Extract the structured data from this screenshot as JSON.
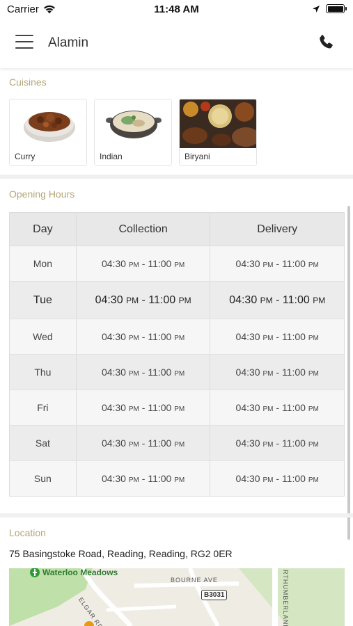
{
  "status_bar": {
    "carrier": "Carrier",
    "time": "11:48 AM"
  },
  "header": {
    "title": "Alamin"
  },
  "cuisines": {
    "label": "Cuisines",
    "items": [
      {
        "label": "Curry"
      },
      {
        "label": "Indian"
      },
      {
        "label": "Biryani"
      }
    ]
  },
  "opening_hours": {
    "label": "Opening Hours",
    "columns": [
      "Day",
      "Collection",
      "Delivery"
    ],
    "rows": [
      {
        "day": "Mon",
        "collection": {
          "open": "04:30",
          "open_ampm": "PM",
          "close": "11:00",
          "close_ampm": "PM"
        },
        "delivery": {
          "open": "04:30",
          "open_ampm": "PM",
          "close": "11:00",
          "close_ampm": "PM"
        }
      },
      {
        "day": "Tue",
        "collection": {
          "open": "04:30",
          "open_ampm": "PM",
          "close": "11:00",
          "close_ampm": "PM"
        },
        "delivery": {
          "open": "04:30",
          "open_ampm": "PM",
          "close": "11:00",
          "close_ampm": "PM"
        }
      },
      {
        "day": "Wed",
        "collection": {
          "open": "04:30",
          "open_ampm": "PM",
          "close": "11:00",
          "close_ampm": "PM"
        },
        "delivery": {
          "open": "04:30",
          "open_ampm": "PM",
          "close": "11:00",
          "close_ampm": "PM"
        }
      },
      {
        "day": "Thu",
        "collection": {
          "open": "04:30",
          "open_ampm": "PM",
          "close": "11:00",
          "close_ampm": "PM"
        },
        "delivery": {
          "open": "04:30",
          "open_ampm": "PM",
          "close": "11:00",
          "close_ampm": "PM"
        }
      },
      {
        "day": "Fri",
        "collection": {
          "open": "04:30",
          "open_ampm": "PM",
          "close": "11:00",
          "close_ampm": "PM"
        },
        "delivery": {
          "open": "04:30",
          "open_ampm": "PM",
          "close": "11:00",
          "close_ampm": "PM"
        }
      },
      {
        "day": "Sat",
        "collection": {
          "open": "04:30",
          "open_ampm": "PM",
          "close": "11:00",
          "close_ampm": "PM"
        },
        "delivery": {
          "open": "04:30",
          "open_ampm": "PM",
          "close": "11:00",
          "close_ampm": "PM"
        }
      },
      {
        "day": "Sun",
        "collection": {
          "open": "04:30",
          "open_ampm": "PM",
          "close": "11:00",
          "close_ampm": "PM"
        },
        "delivery": {
          "open": "04:30",
          "open_ampm": "PM",
          "close": "11:00",
          "close_ampm": "PM"
        }
      }
    ]
  },
  "location": {
    "label": "Location",
    "address": "75 Basingstoke Road, Reading, Reading, RG2 0ER",
    "map": {
      "labels": {
        "park": "Waterloo Meadows",
        "street1": "BOURNE AVE",
        "street2": "ELGAR RD S",
        "road_badge": "B3031",
        "street3": "RTHUMBERLAND"
      }
    }
  },
  "icons": {
    "menu": "hamburger-menu-icon",
    "phone": "phone-icon",
    "wifi": "wifi-icon",
    "location_arrow": "location-arrow-icon",
    "battery": "battery-icon"
  },
  "colors": {
    "section_label": "#b5a67a",
    "header_bg": "#ffffff",
    "table_header_bg": "#e8e8e8",
    "map_park": "#bfe0a8"
  }
}
